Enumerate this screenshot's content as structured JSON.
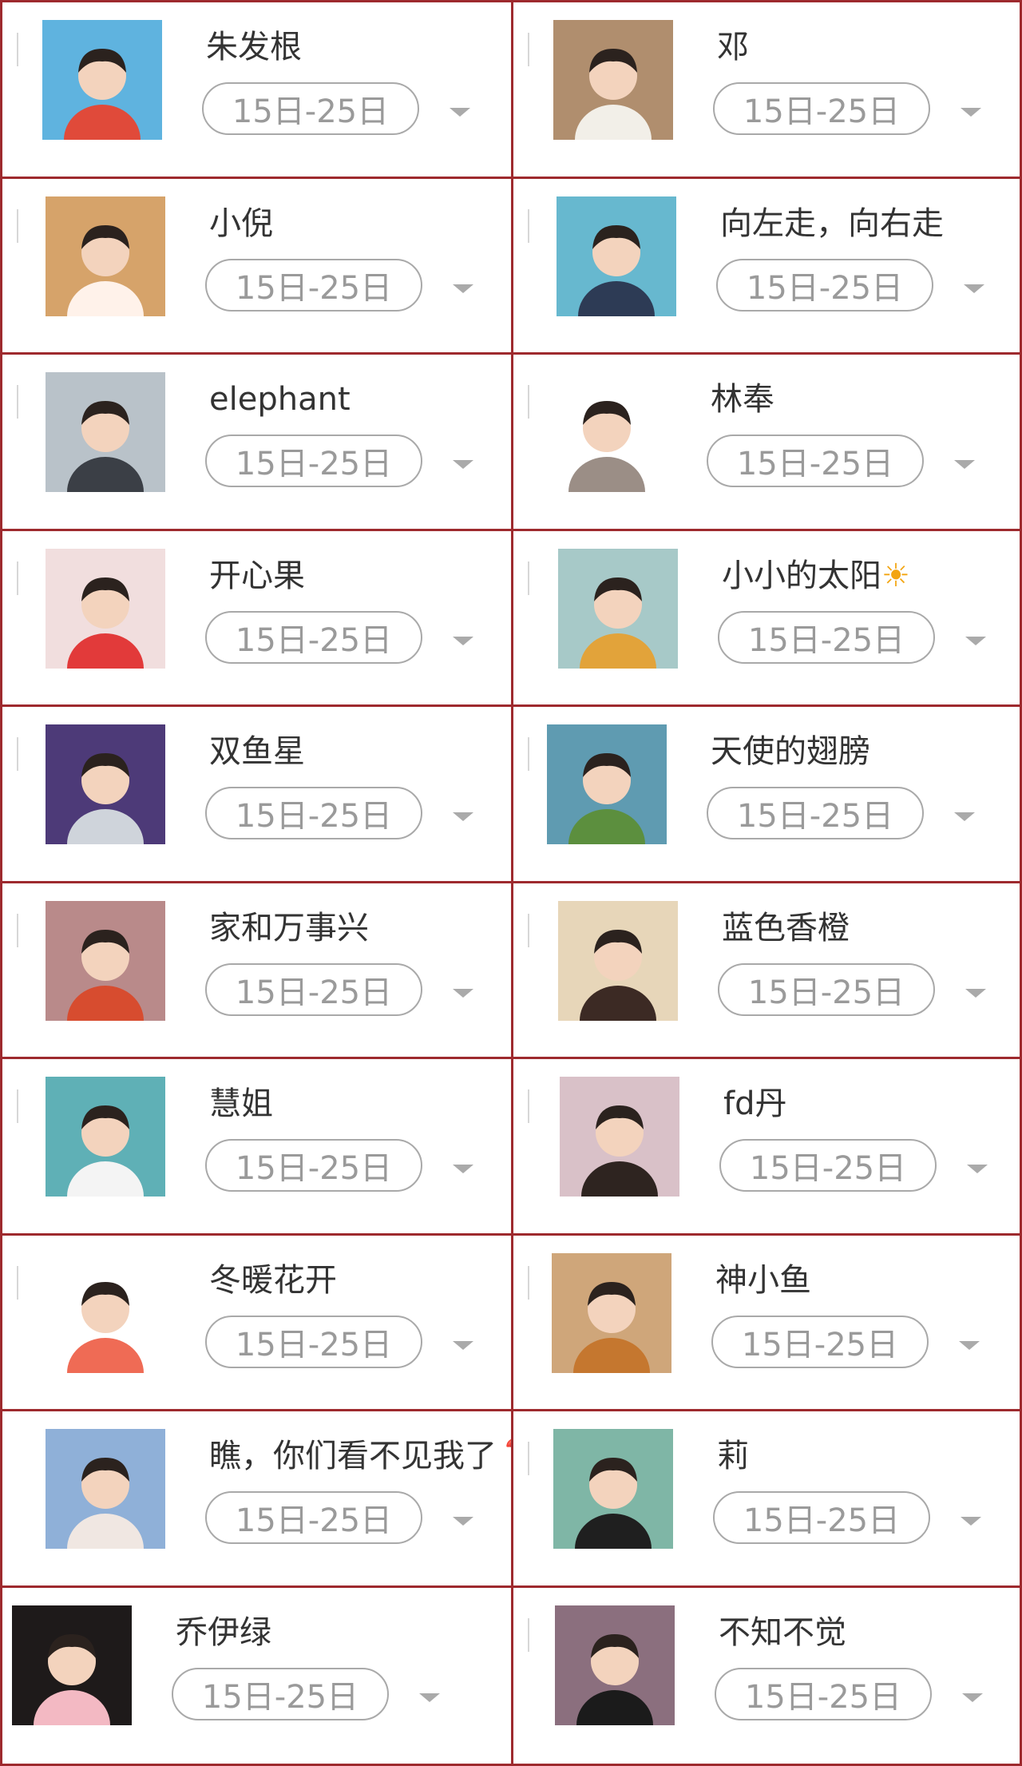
{
  "period_label": "15日-25日",
  "users": [
    {
      "name": "朱发根",
      "avatar": "photo-boy-red-shirt",
      "bg": "#5fb3df",
      "fg": "#e04a3a"
    },
    {
      "name": "邓",
      "avatar": "photo-girl-white-top",
      "bg": "#b08e6e",
      "fg": "#f2efe8"
    },
    {
      "name": "小倪",
      "avatar": "photo-girl-cat-ears",
      "bg": "#d6a36a",
      "fg": "#fff2ea"
    },
    {
      "name": "向左走，向右走",
      "avatar": "cartoon-girl-red-bow",
      "bg": "#67b8cf",
      "fg": "#2d3b55"
    },
    {
      "name": "elephant",
      "avatar": "photo-father-son",
      "bg": "#b9c2c9",
      "fg": "#3b3f46"
    },
    {
      "name": "林奉",
      "avatar": "illustration-woman-hair",
      "bg": "#ffffff",
      "fg": "#9b8e86"
    },
    {
      "name": "开心果",
      "avatar": "photo-girl-red-bow",
      "bg": "#f1dede",
      "fg": "#e23a3a"
    },
    {
      "name": "小小的太阳",
      "name_suffix": "☀",
      "avatar": "photo-lighthouse-sky",
      "bg": "#a7c9c8",
      "fg": "#e2a33a"
    },
    {
      "name": "双鱼星",
      "avatar": "photo-boy-stage",
      "bg": "#4d3a78",
      "fg": "#cfd4db"
    },
    {
      "name": "天使的翅膀",
      "avatar": "photo-mother-child",
      "bg": "#5f9bb1",
      "fg": "#5c8f3e"
    },
    {
      "name": "家和万事兴",
      "avatar": "photo-twin-boys",
      "bg": "#b98a8a",
      "fg": "#d74c2f"
    },
    {
      "name": "蓝色香橙",
      "avatar": "photo-toddler-girl",
      "bg": "#e7d6b9",
      "fg": "#3c2a24"
    },
    {
      "name": "慧姐",
      "avatar": "photo-white-kitten",
      "bg": "#5fb0b6",
      "fg": "#f4f4f4"
    },
    {
      "name": "fd丹",
      "avatar": "photo-girl-cat-filter",
      "bg": "#d9c1c8",
      "fg": "#2e2420"
    },
    {
      "name": "冬暖花开",
      "avatar": "illustration-girl-flower",
      "bg": "#ffffff",
      "fg": "#ef6b55"
    },
    {
      "name": "神小鱼",
      "avatar": "photo-shiba-dog",
      "bg": "#cfa67a",
      "fg": "#c5772f"
    },
    {
      "name": "瞧，你们看不见我了",
      "name_suffix": "❓",
      "avatar": "photo-two-children",
      "bg": "#8fb0d8",
      "fg": "#f0e7e2"
    },
    {
      "name": "莉",
      "avatar": "photo-girl-glasses",
      "bg": "#7fb6a6",
      "fg": "#1f1f1f"
    },
    {
      "name": "乔伊绿",
      "avatar": "cartoon-pig-santa-hat",
      "bg": "#1e1a1a",
      "fg": "#f3b9c3"
    },
    {
      "name": "不知不觉",
      "avatar": "photo-boy-glasses-cap",
      "bg": "#8b6f7e",
      "fg": "#1b1b1b"
    }
  ]
}
